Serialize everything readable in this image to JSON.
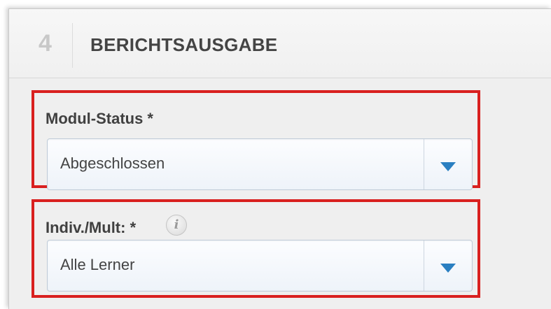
{
  "section": {
    "step_number": "4",
    "title": "BERICHTSAUSGABE"
  },
  "fields": {
    "modul_status": {
      "label": "Modul-Status *",
      "value": "Abgeschlossen"
    },
    "indiv_mult": {
      "label": "Indiv./Mult: *",
      "value": "Alle Lerner",
      "info_icon": "info-icon"
    }
  },
  "colors": {
    "highlight_border": "#d9201f",
    "dropdown_arrow": "#2a7fc1"
  }
}
